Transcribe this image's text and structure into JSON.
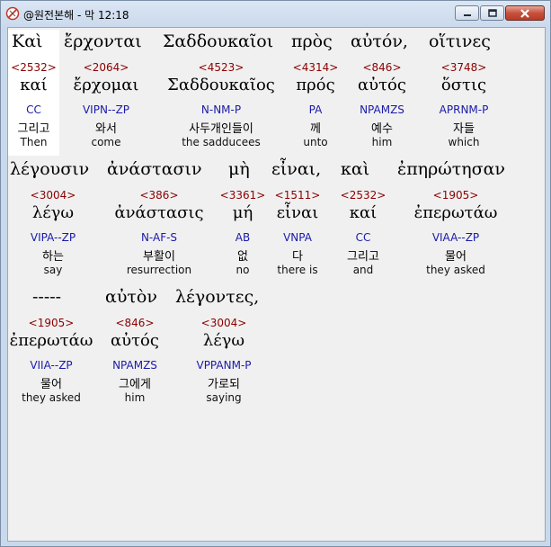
{
  "window": {
    "title": "@원전본해 - 막 12:18",
    "icon": "app-icon",
    "controls": [
      "minimize-button",
      "maximize-button",
      "close-button"
    ]
  },
  "lines": [
    {
      "words": [
        {
          "greek": "Καὶ",
          "strong": "<2532>",
          "lemma": "καί",
          "parse": "CC",
          "korean": "그리고",
          "english": "Then",
          "selected": true
        },
        {
          "greek": "ἔρχονται",
          "strong": "<2064>",
          "lemma": "ἔρχομαι",
          "parse": "VIPN--ZP",
          "korean": "와서",
          "english": "come"
        },
        {
          "greek": "Σαδδουκαῖοι",
          "strong": "<4523>",
          "lemma": "Σαδδουκαῖος",
          "parse": "N-NM-P",
          "korean": "사두개인들이",
          "english": "the sadducees"
        },
        {
          "greek": "πρὸς",
          "strong": "<4314>",
          "lemma": "πρός",
          "parse": "PA",
          "korean": "께",
          "english": "unto"
        },
        {
          "greek": "αὐτόν,",
          "strong": "<846>",
          "lemma": "αὐτός",
          "parse": "NPAMZS",
          "korean": "예수",
          "english": "him"
        },
        {
          "greek": "οἵτινες",
          "strong": "<3748>",
          "lemma": "ὅστις",
          "parse": "APRNM-P",
          "korean": "자들",
          "english": "which"
        }
      ]
    },
    {
      "words": [
        {
          "greek": "λέγουσιν",
          "strong": "<3004>",
          "lemma": "λέγω",
          "parse": "VIPA--ZP",
          "korean": "하는",
          "english": "say"
        },
        {
          "greek": "ἀνάστασιν",
          "strong": "<386>",
          "lemma": "ἀνάστασις",
          "parse": "N-AF-S",
          "korean": "부활이",
          "english": "resurrection"
        },
        {
          "greek": "μὴ",
          "strong": "<3361>",
          "lemma": "μή",
          "parse": "AB",
          "korean": "없",
          "english": "no"
        },
        {
          "greek": "εἶναι,",
          "strong": "<1511>",
          "lemma": "εἶναι",
          "parse": "VNPA",
          "korean": "다",
          "english": "there is"
        },
        {
          "greek": "καὶ",
          "strong": "<2532>",
          "lemma": "καί",
          "parse": "CC",
          "korean": "그리고",
          "english": "and"
        },
        {
          "greek": "ἐπηρώτησαν",
          "strong": "<1905>",
          "lemma": "ἐπερωτάω",
          "parse": "VIAA--ZP",
          "korean": "물어",
          "english": "they asked"
        }
      ]
    },
    {
      "words": [
        {
          "greek": "-----",
          "strong": "<1905>",
          "lemma": "ἐπερωτάω",
          "parse": "VIIA--ZP",
          "korean": "물어",
          "english": "they asked"
        },
        {
          "greek": "αὐτὸν",
          "strong": "<846>",
          "lemma": "αὐτός",
          "parse": "NPAMZS",
          "korean": "그에게",
          "english": "him"
        },
        {
          "greek": "λέγοντες,",
          "strong": "<3004>",
          "lemma": "λέγω",
          "parse": "VPPANM-P",
          "korean": "가로되",
          "english": "saying"
        }
      ]
    }
  ]
}
